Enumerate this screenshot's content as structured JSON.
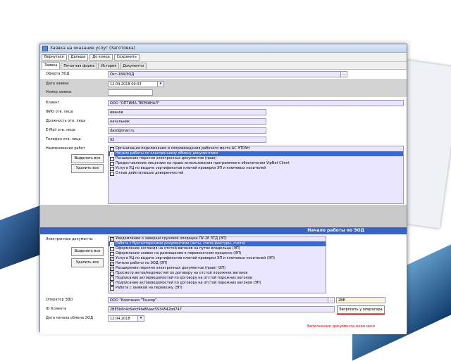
{
  "window": {
    "title": "Заявка на оказание услуг (Заготовка)"
  },
  "toolbar": {
    "buttons": [
      "Вернуться",
      "Дальше",
      "До конца",
      "Сохранить"
    ]
  },
  "tabs": [
    "Заявка",
    "Печатная форма",
    "История",
    "Документы"
  ],
  "form": {
    "offer_label": "Оферта ЭОД",
    "offer_value": "Окт-184/ЭОД",
    "date_label": "Дата заявки",
    "date_value": "12.04.2018  09:03",
    "number_label": "Номер заявки",
    "number_value": "",
    "client_label": "Клиент",
    "client_value": "ООО \"ОПТИМА-ТЕРМИНАЛ\"",
    "fio_label": "ФИО отв. лица",
    "fio_value": "иванов",
    "position_label": "Должность отв. лица",
    "position_value": "начальник",
    "email_label": "E-Mail отв. лица",
    "email_value": "dasd@mail.ru",
    "phone_label": "Телефон отв. лица",
    "phone_value": "92",
    "works_label": "Наименования работ",
    "select_all": "Выделить все",
    "remove_all": "Удалить все",
    "works": [
      {
        "label": "Организация подключения и сопровождения рабочего места АС ЭТРАН",
        "checked": false,
        "selected": false
      },
      {
        "label": "Начало работы по электронному обмену документами",
        "checked": true,
        "selected": true
      },
      {
        "label": "Расширение перечня электронных документов (прав)",
        "checked": false,
        "selected": false
      },
      {
        "label": "Предоставление лицензии на право использования программного обеспечения VipNet Client",
        "checked": false,
        "selected": false
      },
      {
        "label": "Услуга УЦ по выдаче сертификатов ключей проверки ЭП и ключевых носителей",
        "checked": false,
        "selected": false
      },
      {
        "label": "Отзыв действующих доверенностей",
        "checked": false,
        "selected": false
      }
    ]
  },
  "section": {
    "start_title": "Начало работы по ЭОД"
  },
  "edocs": {
    "label": "Электронные документы",
    "select_all": "Выделить все",
    "remove_all": "Удалить все",
    "items": [
      {
        "label": "Уведомление о заверши грузовой операции ПУ-26 ЗТД (ЭП)",
        "checked": true,
        "selected": false
      },
      {
        "label": "Работа с бухгалтерскими документами (акты, счета-фактуры, счета)",
        "checked": true,
        "selected": true
      },
      {
        "label": "Оформление согласия на отстой вагонов на путях владельца (ЭП)",
        "checked": false,
        "selected": false
      },
      {
        "label": "Оформление заявок на размещение в перевозочном процессе (ЭП)",
        "checked": false,
        "selected": false
      },
      {
        "label": "Услуга УЦ по выдаче сертификатов ключей проверки ЭП и ключевых носителей (ЭП)",
        "checked": true,
        "selected": false
      },
      {
        "label": "Начало работы по ЭОД (ЭП)",
        "checked": true,
        "selected": false
      },
      {
        "label": "Расширение перечня электронных документов (прав) (ЭП)",
        "checked": true,
        "selected": false
      },
      {
        "label": "Просмотр актов/ведомостей по договору на отстой порожних вагонов",
        "checked": false,
        "selected": false
      },
      {
        "label": "Подписание актов/ведомостей по договору на отстой порожних вагонов",
        "checked": false,
        "selected": false
      },
      {
        "label": "Подписание актов/ведомостей по договору на отстой порожних вагонов (ЭП)",
        "checked": false,
        "selected": false
      },
      {
        "label": "Работа с заявкой на перевозку (ЭП)",
        "checked": false,
        "selected": false
      }
    ]
  },
  "operator": {
    "label": "Оператор ЭДО",
    "value": "ООО \"Компания \"Тензор\"",
    "code": "2BE"
  },
  "client_id": {
    "label": "ID Клиента",
    "value": "2BE5b6c4c6afcf4fa86aac5934542bd747",
    "request_button": "Запросить у оператора"
  },
  "start_date": {
    "label": "Дата начала обмена ЭОД",
    "value": "12.04.2018"
  },
  "status": {
    "text": "Заполнение документа окончено"
  },
  "colors": {
    "section_bar": "#3b63c6",
    "selection": "#3469d8",
    "field_bg": "#ebe6ff",
    "status_red": "#d30000"
  }
}
